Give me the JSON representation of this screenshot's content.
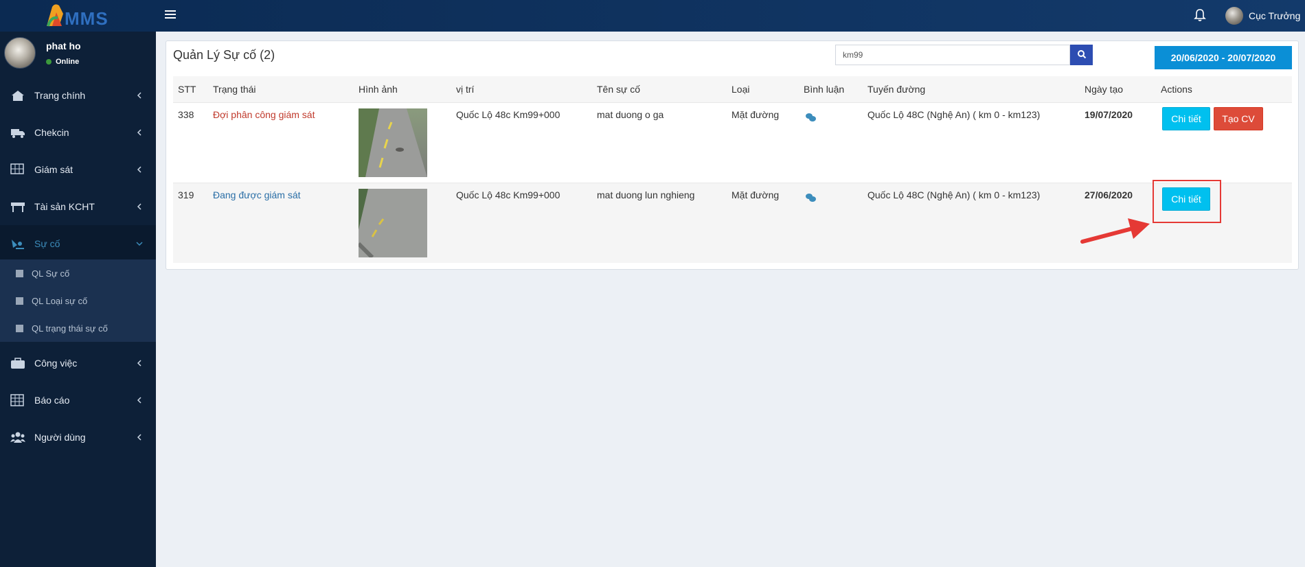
{
  "header": {
    "logo_text": "MMS",
    "user_name": "Cục Trưởng"
  },
  "sidebar": {
    "user": {
      "name": "phat ho",
      "status": "Online"
    },
    "items": [
      {
        "label": "Trang chính",
        "icon": "home-icon"
      },
      {
        "label": "Chekcin",
        "icon": "truck-icon"
      },
      {
        "label": "Giám sát",
        "icon": "monitor-grid-icon"
      },
      {
        "label": "Tài sản KCHT",
        "icon": "road-barrier-icon"
      },
      {
        "label": "Sự cố",
        "icon": "incident-icon"
      },
      {
        "label": "Công việc",
        "icon": "briefcase-icon"
      },
      {
        "label": "Báo cáo",
        "icon": "table-icon"
      },
      {
        "label": "Người dùng",
        "icon": "users-icon"
      }
    ],
    "submenu": [
      {
        "label": "QL Sự cố"
      },
      {
        "label": "QL Loại sự cố"
      },
      {
        "label": "QL trạng thái sự cố"
      }
    ]
  },
  "main": {
    "title": "Quản Lý Sự cố (2)",
    "search": {
      "value": "km99"
    },
    "date_range": "20/06/2020 - 20/07/2020",
    "columns": [
      "STT",
      "Trạng thái",
      "Hình ảnh",
      "vị trí",
      "Tên sự cố",
      "Loại",
      "Bình luận",
      "Tuyến đường",
      "Ngày tạo",
      "Actions"
    ],
    "rows": [
      {
        "stt": "338",
        "status": "Đợi phân công giám sát",
        "location": "Quốc Lộ 48c Km99+000",
        "name": "mat duong o ga",
        "type": "Mặt đường",
        "route": "Quốc Lộ 48C (Nghệ An) ( km 0 - km123)",
        "date": "19/07/2020",
        "detail_label": "Chi tiết",
        "create_label": "Tạo CV"
      },
      {
        "stt": "319",
        "status": "Đang được giám sát",
        "location": "Quốc Lộ 48c Km99+000",
        "name": "mat duong lun nghieng",
        "type": "Mặt đường",
        "route": "Quốc Lộ 48C (Nghệ An) ( km 0 - km123)",
        "date": "27/06/2020",
        "detail_label": "Chi tiết"
      }
    ]
  },
  "colors": {
    "header_bg": "#0b2a52",
    "sidebar_bg": "#0d2038",
    "info": "#00c0ef",
    "danger": "#dd4b39",
    "date_btn": "#0b8fd6",
    "highlight": "#e53935"
  }
}
